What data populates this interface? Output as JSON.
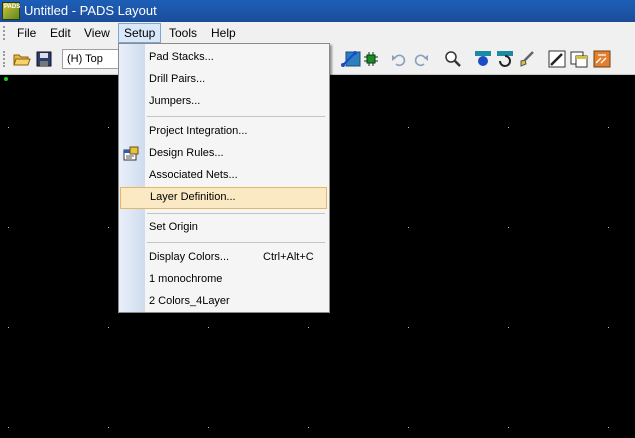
{
  "window": {
    "title": "Untitled - PADS Layout",
    "icon_text": "PADS"
  },
  "menubar": {
    "items": [
      {
        "label": "File",
        "name": "menu-file"
      },
      {
        "label": "Edit",
        "name": "menu-edit"
      },
      {
        "label": "View",
        "name": "menu-view"
      },
      {
        "label": "Setup",
        "name": "menu-setup"
      },
      {
        "label": "Tools",
        "name": "menu-tools"
      },
      {
        "label": "Help",
        "name": "menu-help"
      }
    ]
  },
  "toolbar": {
    "layer_value": "(H) Top"
  },
  "setup_menu": {
    "items": [
      {
        "label": "Pad Stacks...",
        "shortcut": ""
      },
      {
        "label": "Drill Pairs...",
        "shortcut": ""
      },
      {
        "label": "Jumpers...",
        "shortcut": ""
      },
      {
        "label": "Project Integration...",
        "shortcut": ""
      },
      {
        "label": "Design Rules...",
        "shortcut": ""
      },
      {
        "label": "Associated Nets...",
        "shortcut": ""
      },
      {
        "label": "Layer Definition...",
        "shortcut": ""
      },
      {
        "label": "Set Origin",
        "shortcut": ""
      },
      {
        "label": "Display Colors...",
        "shortcut": "Ctrl+Alt+C"
      },
      {
        "label": "1 monochrome",
        "shortcut": ""
      },
      {
        "label": "2 Colors_4Layer",
        "shortcut": ""
      }
    ],
    "highlighted": "Layer Definition..."
  },
  "colors": {
    "canvas": "#000000",
    "origin": "#19d019",
    "highlight": "#fbe9c4",
    "title_bar": "#1c5fb8"
  }
}
